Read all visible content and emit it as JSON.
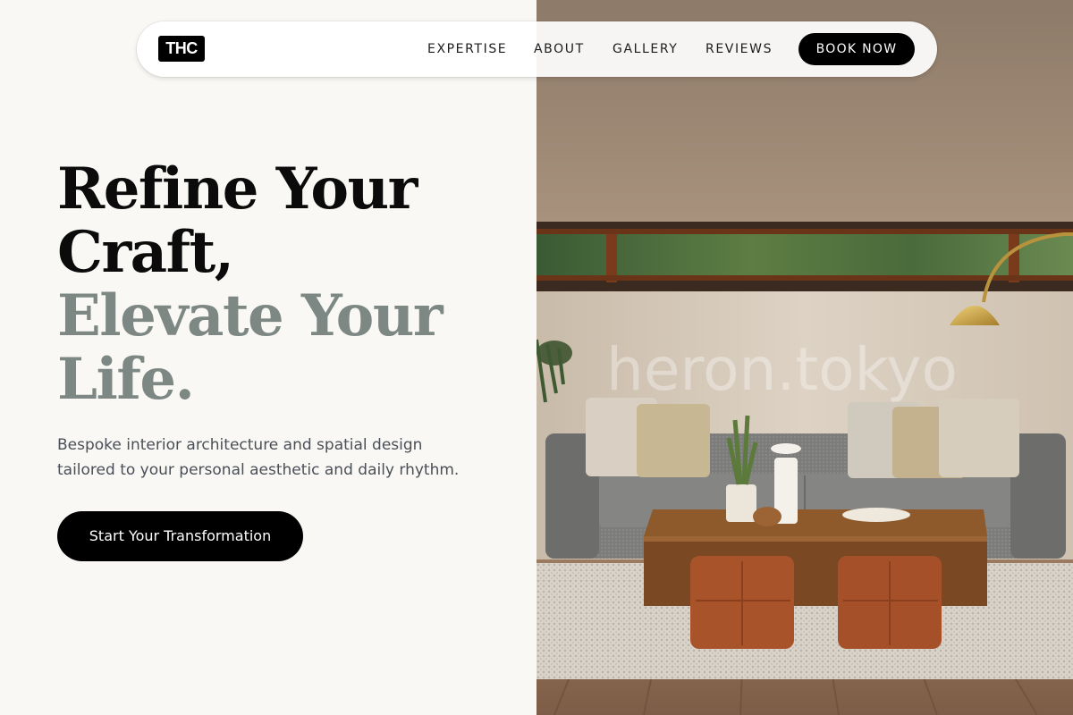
{
  "nav": {
    "logo_text": "THC",
    "links": [
      "EXPERTISE",
      "ABOUT",
      "GALLERY",
      "REVIEWS"
    ],
    "book_label": "BOOK NOW"
  },
  "hero": {
    "headline_dark": [
      "Refine Your",
      "Craft,"
    ],
    "headline_muted": [
      "Elevate Your",
      "Life."
    ],
    "subtitle_lines": [
      "Bespoke interior architecture and spatial design",
      "tailored to your personal aesthetic and daily rhythm."
    ],
    "cta_label": "Start Your Transformation"
  },
  "image": {
    "watermark": "heron.tokyo",
    "description_icon": "living-room-photo"
  },
  "colors": {
    "background": "#f9f8f5",
    "accent_black": "#000000",
    "muted_headline": "#7d8884",
    "body_text": "#4a4f57"
  }
}
